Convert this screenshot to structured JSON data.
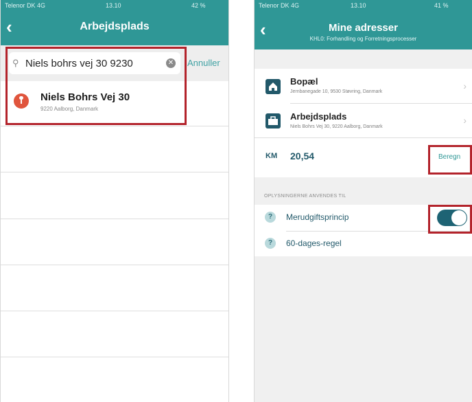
{
  "left_screen": {
    "status": {
      "carrier": "Telenor DK  4G",
      "time": "13.10",
      "battery": "42 %"
    },
    "nav": {
      "title": "Arbejdsplads"
    },
    "search": {
      "value": "Niels bohrs vej 30 9230",
      "cancel_label": "Annuller"
    },
    "results": [
      {
        "title": "Niels Bohrs Vej 30",
        "subtitle": "9220 Aalborg, Danmark"
      }
    ]
  },
  "right_screen": {
    "status": {
      "carrier": "Telenor DK  4G",
      "time": "13.10",
      "battery": "41 %"
    },
    "nav": {
      "title": "Mine adresser",
      "subtitle": "KHL0: Forhandling og Forretningsprocesser"
    },
    "addresses": [
      {
        "title": "Bopæl",
        "subtitle": "Jernbanegade 10, 9530 Støvring, Danmark",
        "icon": "home-icon"
      },
      {
        "title": "Arbejdsplads",
        "subtitle": "Niels Bohrs Vej 30, 9220 Aalborg, Danmark",
        "icon": "briefcase-icon"
      }
    ],
    "km": {
      "label": "KM",
      "value": "20,54",
      "button_label": "Beregn"
    },
    "usage": {
      "header": "OPLYSNINGERNE ANVENDES TIL",
      "items": [
        {
          "label": "Merudgiftsprincip",
          "toggle_on": true
        },
        {
          "label": "60-dages-regel"
        }
      ]
    }
  },
  "colors": {
    "header": "#2f9796",
    "accent_dark": "#22596a",
    "highlight_box": "#b3232b",
    "pin": "#e0553d"
  }
}
